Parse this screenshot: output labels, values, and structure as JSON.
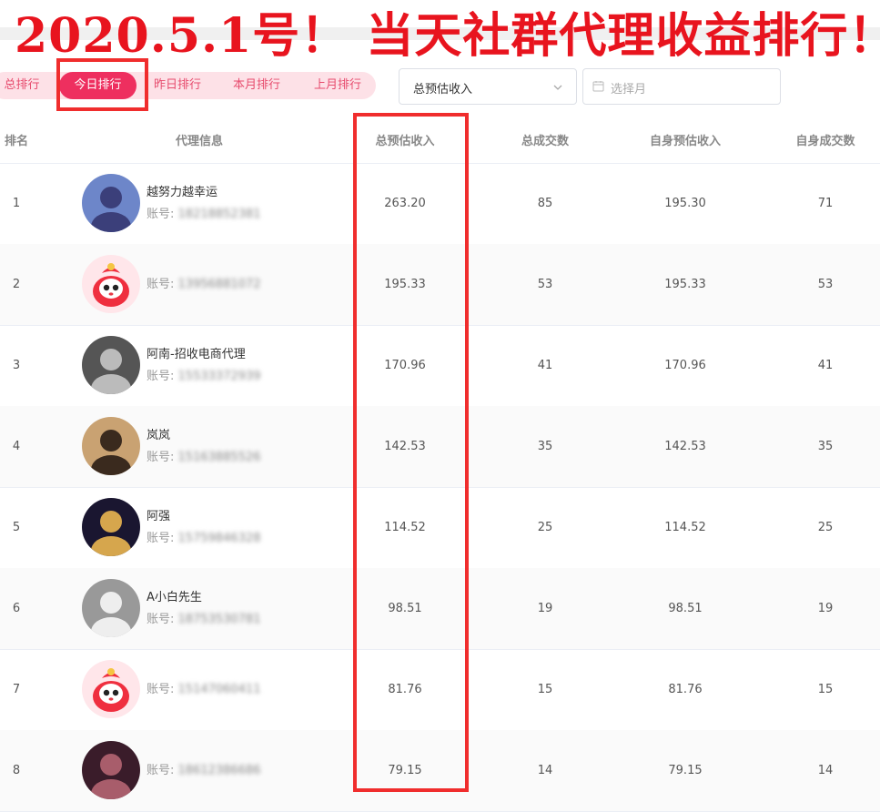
{
  "banner": {
    "title": "2020.5.1号！ 当天社群代理收益排行！"
  },
  "tabs": [
    "总排行",
    "今日排行",
    "昨日排行",
    "本月排行",
    "上月排行"
  ],
  "active_tab": "今日排行",
  "filters": {
    "sort_select": "总预估收入",
    "month_placeholder": "选择月"
  },
  "table": {
    "headers": [
      "排名",
      "代理信息",
      "总预估收入",
      "总成交数",
      "自身预估收入",
      "自身成交数"
    ],
    "rows": [
      {
        "rank": "1",
        "name": "越努力越幸运",
        "account_label": "账号:",
        "account": "18218852381",
        "total_income": "263.20",
        "total_orders": "85",
        "self_income": "195.30",
        "self_orders": "71",
        "avatar_icon": "avatar-photo-person-icon"
      },
      {
        "rank": "2",
        "name": "",
        "account_label": "账号:",
        "account": "13956881072",
        "total_income": "195.33",
        "total_orders": "53",
        "self_income": "195.33",
        "self_orders": "53",
        "avatar_icon": "avatar-mascot-icon"
      },
      {
        "rank": "3",
        "name": "阿南-招收电商代理",
        "account_label": "账号:",
        "account": "15533372939",
        "total_income": "170.96",
        "total_orders": "41",
        "self_income": "170.96",
        "self_orders": "41",
        "avatar_icon": "avatar-photo-person-icon"
      },
      {
        "rank": "4",
        "name": "岚岚",
        "account_label": "账号:",
        "account": "15163885526",
        "total_income": "142.53",
        "total_orders": "35",
        "self_income": "142.53",
        "self_orders": "35",
        "avatar_icon": "avatar-photo-person-icon"
      },
      {
        "rank": "5",
        "name": "阿强",
        "account_label": "账号:",
        "account": "15759846328",
        "total_income": "114.52",
        "total_orders": "25",
        "self_income": "114.52",
        "self_orders": "25",
        "avatar_icon": "avatar-photo-person-icon"
      },
      {
        "rank": "6",
        "name": "A小白先生",
        "account_label": "账号:",
        "account": "18753530781",
        "total_income": "98.51",
        "total_orders": "19",
        "self_income": "98.51",
        "self_orders": "19",
        "avatar_icon": "avatar-photo-person-icon"
      },
      {
        "rank": "7",
        "name": "",
        "account_label": "账号:",
        "account": "15147060411",
        "total_income": "81.76",
        "total_orders": "15",
        "self_income": "81.76",
        "self_orders": "15",
        "avatar_icon": "avatar-mascot-icon"
      },
      {
        "rank": "8",
        "name": "",
        "account_label": "账号:",
        "account": "18612386686",
        "total_income": "79.15",
        "total_orders": "14",
        "self_income": "79.15",
        "self_orders": "14",
        "avatar_icon": "avatar-photo-person-icon"
      }
    ]
  },
  "colors": {
    "banner_red": "#e8141e",
    "tab_bg": "#fde1e7",
    "tab_active": "#ee2f5f",
    "highlight_box": "#f02d2d"
  }
}
